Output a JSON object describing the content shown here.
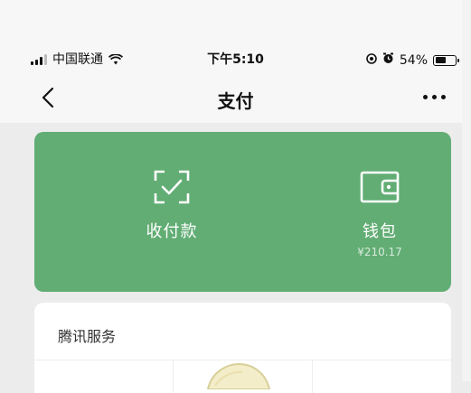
{
  "status_bar": {
    "carrier": "中国联通",
    "time": "下午5:10",
    "battery": "54%",
    "battery_level": 0.54
  },
  "nav": {
    "title": "支付"
  },
  "wallet_card": {
    "accent_color": "#62ad74",
    "pay": {
      "label": "收付款",
      "icon": "qr-scan-icon"
    },
    "wallet": {
      "label": "钱包",
      "balance": "¥210.17",
      "icon": "wallet-icon"
    }
  },
  "services": {
    "title": "腾讯服务",
    "first_icon": "service-app-icon"
  }
}
